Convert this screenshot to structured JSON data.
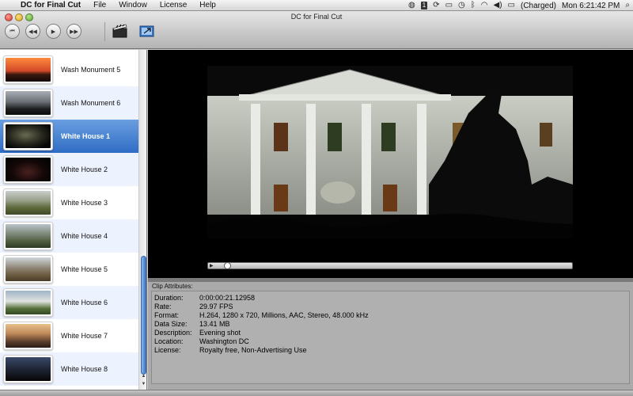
{
  "menubar": {
    "apple": "",
    "app_name": "DC for Final Cut",
    "menus": [
      "File",
      "Window",
      "License",
      "Help"
    ],
    "status": {
      "battery": "(Charged)",
      "clock": "Mon 6:21:42 PM",
      "date_badge": "1"
    }
  },
  "window": {
    "title": "DC for Final Cut"
  },
  "toolbar": {
    "buttons": [
      {
        "name": "skip-back-button",
        "glyph": "⏮"
      },
      {
        "name": "rewind-button",
        "glyph": "◀◀"
      },
      {
        "name": "play-button",
        "glyph": "▶"
      },
      {
        "name": "fast-forward-button",
        "glyph": "▶▶"
      }
    ]
  },
  "clips": [
    {
      "label": "Wash Monument 5"
    },
    {
      "label": "Wash Monument 6"
    },
    {
      "label": "White House 1",
      "selected": true
    },
    {
      "label": "White House 2"
    },
    {
      "label": "White House 3"
    },
    {
      "label": "White House 4"
    },
    {
      "label": "White House 5"
    },
    {
      "label": "White House 6"
    },
    {
      "label": "White House 7"
    },
    {
      "label": "White House 8"
    }
  ],
  "attributes": {
    "title": "Clip Attributes:",
    "rows": [
      {
        "label": "Duration:",
        "value": "0:00:00:21.12958"
      },
      {
        "label": "Rate:",
        "value": "29.97 FPS"
      },
      {
        "label": "Format:",
        "value": "H.264, 1280 x 720, Millions, AAC, Stereo, 48.000 kHz"
      },
      {
        "label": "Data Size:",
        "value": "13.41 MB"
      },
      {
        "label": "Description:",
        "value": "Evening shot"
      },
      {
        "label": "Location:",
        "value": "Washington DC"
      },
      {
        "label": "License:",
        "value": "Royalty free, Non-Advertising Use"
      }
    ]
  },
  "player": {
    "progress": 0.02
  }
}
